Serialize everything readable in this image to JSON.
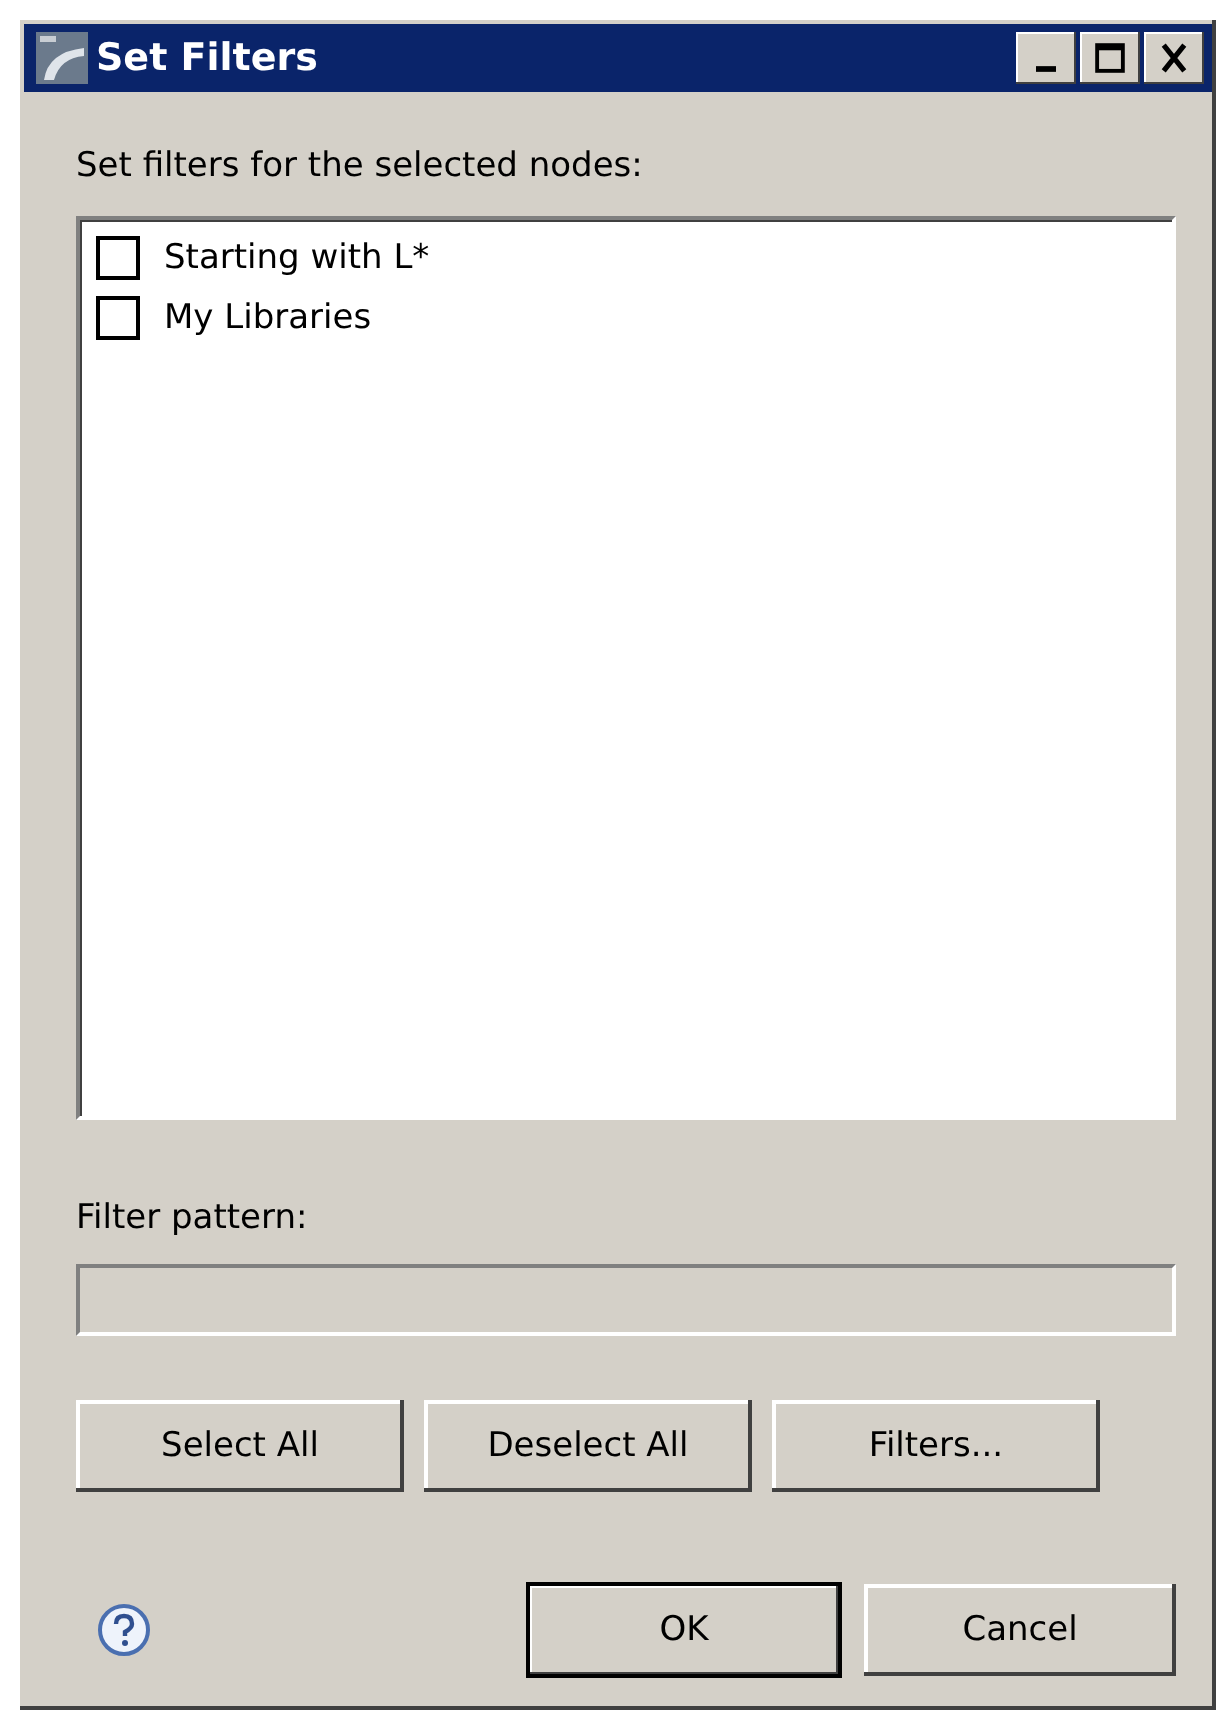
{
  "window": {
    "title": "Set Filters"
  },
  "prompt": "Set filters for the selected nodes:",
  "filters": [
    {
      "label": "Starting with L*",
      "checked": false
    },
    {
      "label": "My Libraries",
      "checked": false
    }
  ],
  "filter_pattern": {
    "label": "Filter pattern:",
    "disabled": true
  },
  "list_buttons": [
    "Select All",
    "Deselect All",
    "Filters..."
  ],
  "dialog_buttons": [
    {
      "label": "OK",
      "default": true
    },
    {
      "label": "Cancel",
      "default": false
    }
  ]
}
